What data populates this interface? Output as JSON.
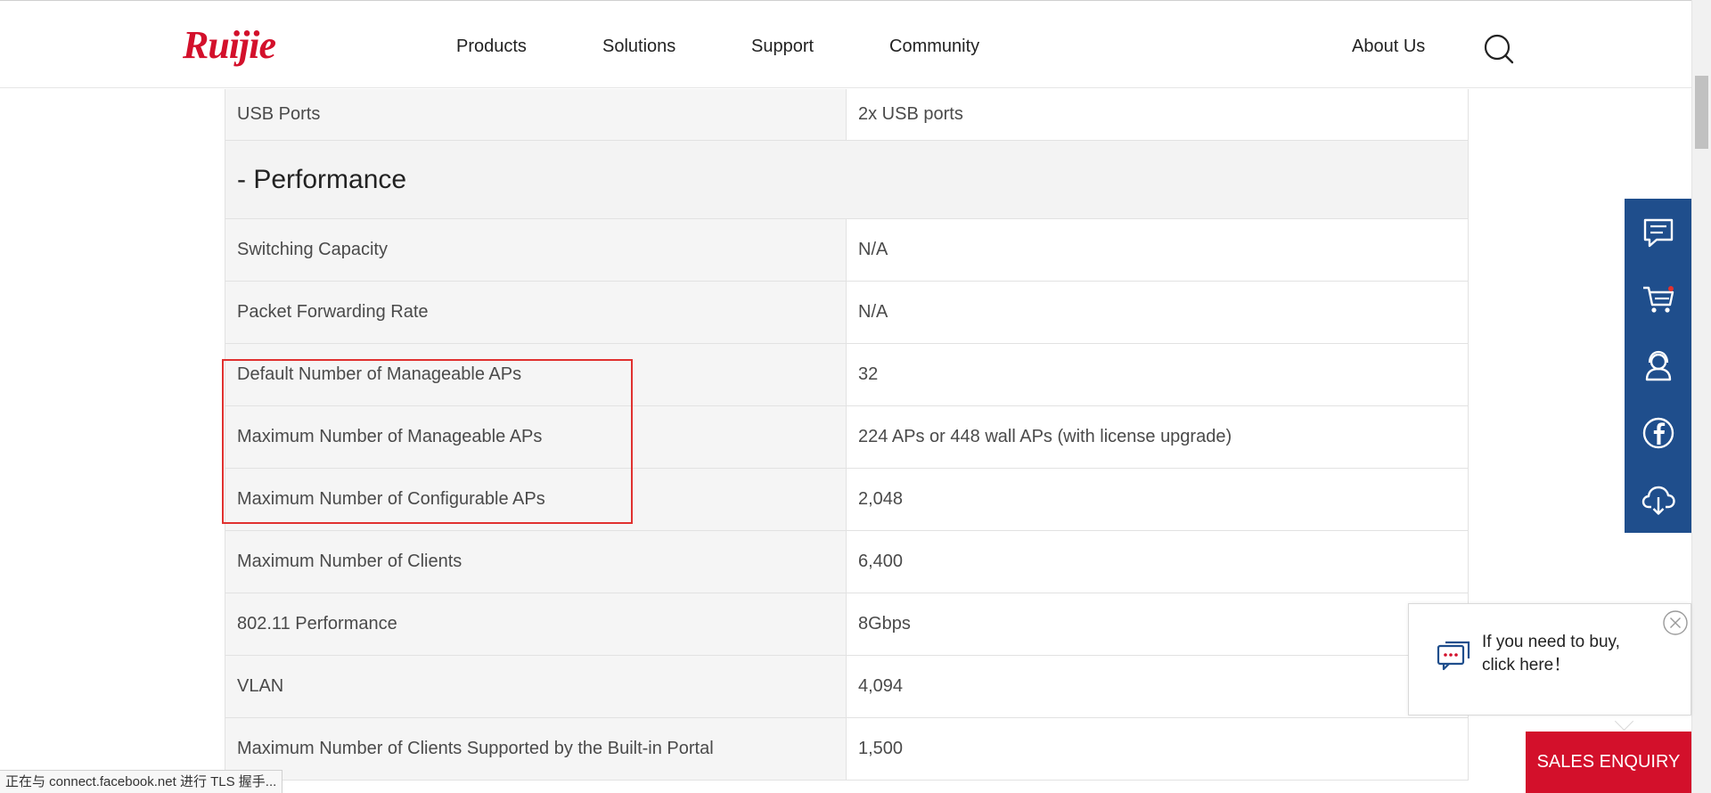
{
  "header": {
    "logo_text": "Ruijie",
    "nav": [
      "Products",
      "Solutions",
      "Support",
      "Community"
    ],
    "about_label": "About Us"
  },
  "table": {
    "first_row": {
      "label": "USB Ports",
      "value": "2x USB ports"
    },
    "section_title": "- Performance",
    "rows": [
      {
        "label": "Switching Capacity",
        "value": "N/A"
      },
      {
        "label": "Packet Forwarding Rate",
        "value": "N/A"
      },
      {
        "label": "Default Number of Manageable APs",
        "value": "32"
      },
      {
        "label": "Maximum Number of Manageable APs",
        "value": "224 APs or 448 wall APs (with license upgrade)"
      },
      {
        "label": "Maximum Number of Configurable APs",
        "value": "2,048"
      },
      {
        "label": "Maximum Number of Clients",
        "value": "6,400"
      },
      {
        "label": "802.11 Performance",
        "value": "8Gbps"
      },
      {
        "label": "VLAN",
        "value": "4,094"
      },
      {
        "label": "Maximum Number of Clients Supported by the Built-in Portal",
        "value": "1,500"
      }
    ]
  },
  "side_toolbar": {
    "icons": [
      "chat-icon",
      "cart-icon",
      "support-agent-icon",
      "facebook-icon",
      "cloud-download-icon"
    ]
  },
  "popup": {
    "line1": "If you need to buy,",
    "line2": "click here！"
  },
  "sales_enquiry_label": "SALES ENQUIRY",
  "status_bar_text": "正在与 connect.facebook.net 进行 TLS 握手...",
  "colors": {
    "brand_red": "#d3102b",
    "toolbar_blue": "#1f4e8c",
    "highlight_red": "#e0312f"
  }
}
